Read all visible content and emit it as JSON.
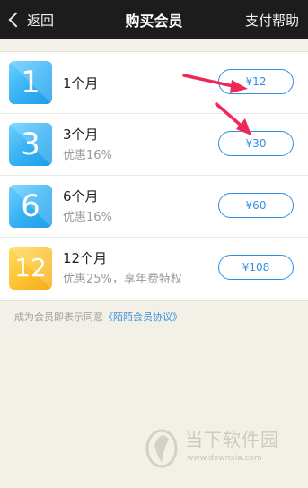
{
  "navbar": {
    "back_label": "返回",
    "title": "购买会员",
    "help_label": "支付帮助"
  },
  "plans": [
    {
      "tile_number": "1",
      "tile_color": "#36b2f4",
      "title": "1个月",
      "subtitle": "",
      "price": "¥12"
    },
    {
      "tile_number": "3",
      "tile_color": "#36b2f4",
      "title": "3个月",
      "subtitle": "优惠16%",
      "price": "¥30"
    },
    {
      "tile_number": "6",
      "tile_color": "#36b2f4",
      "title": "6个月",
      "subtitle": "优惠16%",
      "price": "¥60"
    },
    {
      "tile_number": "12",
      "tile_color": "#fdc332",
      "title": "12个月",
      "subtitle": "优惠25%，享年费特权",
      "price": "¥108"
    }
  ],
  "agreement": {
    "prefix": "成为会员即表示同意",
    "link": "《陌陌会员协议》"
  },
  "watermark": {
    "brand": "当下软件园",
    "url": "www.downxia.com"
  },
  "colors": {
    "accent": "#2f8fe8",
    "annotation_arrow": "#f0285a",
    "navbar_bg": "#1c1c1c",
    "page_bg": "#f3f0e8"
  }
}
